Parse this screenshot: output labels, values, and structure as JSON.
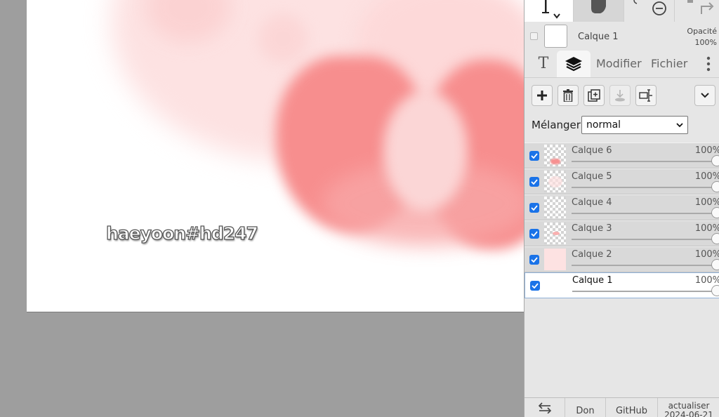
{
  "canvas": {
    "watermark": "haeyoon#hd247",
    "colors": {
      "blush": "#f9c9c9",
      "bow": "#f77e7e",
      "bow_center": "#fbd0d0",
      "background": "#ffffff"
    }
  },
  "toolbar_top": {
    "tools": [
      {
        "name": "text-tool",
        "icon": "text-cursor-icon"
      },
      {
        "name": "hand-tool",
        "icon": "hand-icon"
      },
      {
        "name": "zoom-out-tool",
        "icon": "zoom-out-icon"
      },
      {
        "name": "redo-tool",
        "icon": "redo-icon"
      }
    ]
  },
  "layer_header": {
    "layer_name": "Calque 1",
    "opacity_label": "Opacité",
    "opacity_value": "100%"
  },
  "tabs": {
    "text_tab": "T",
    "layers_tab_icon": "layers-icon",
    "modifier": "Modifier",
    "file": "Fichier",
    "more_icon": "more-vertical-icon"
  },
  "layer_actions": [
    {
      "name": "add-layer",
      "icon": "plus-icon"
    },
    {
      "name": "delete-layer",
      "icon": "trash-icon"
    },
    {
      "name": "duplicate-layer",
      "icon": "duplicate-icon"
    },
    {
      "name": "merge-down",
      "icon": "merge-down-icon"
    },
    {
      "name": "rename-layer",
      "icon": "rename-icon"
    },
    {
      "name": "expand",
      "icon": "chevron-down-icon"
    }
  ],
  "blend": {
    "label": "Mélanger",
    "selected": "normal"
  },
  "layers": [
    {
      "name": "Calque 6",
      "opacity": "100%",
      "visible": true,
      "active": false
    },
    {
      "name": "Calque 5",
      "opacity": "100%",
      "visible": true,
      "active": false
    },
    {
      "name": "Calque 4",
      "opacity": "100%",
      "visible": true,
      "active": false
    },
    {
      "name": "Calque 3",
      "opacity": "100%",
      "visible": true,
      "active": false
    },
    {
      "name": "Calque 2",
      "opacity": "100%",
      "visible": true,
      "active": false
    },
    {
      "name": "Calque 1",
      "opacity": "100%",
      "visible": true,
      "active": true
    }
  ],
  "footer": {
    "swap_icon": "swap-arrows-icon",
    "don": "Don",
    "github": "GitHub",
    "update": "actualiser",
    "version": "2024-06-21"
  }
}
